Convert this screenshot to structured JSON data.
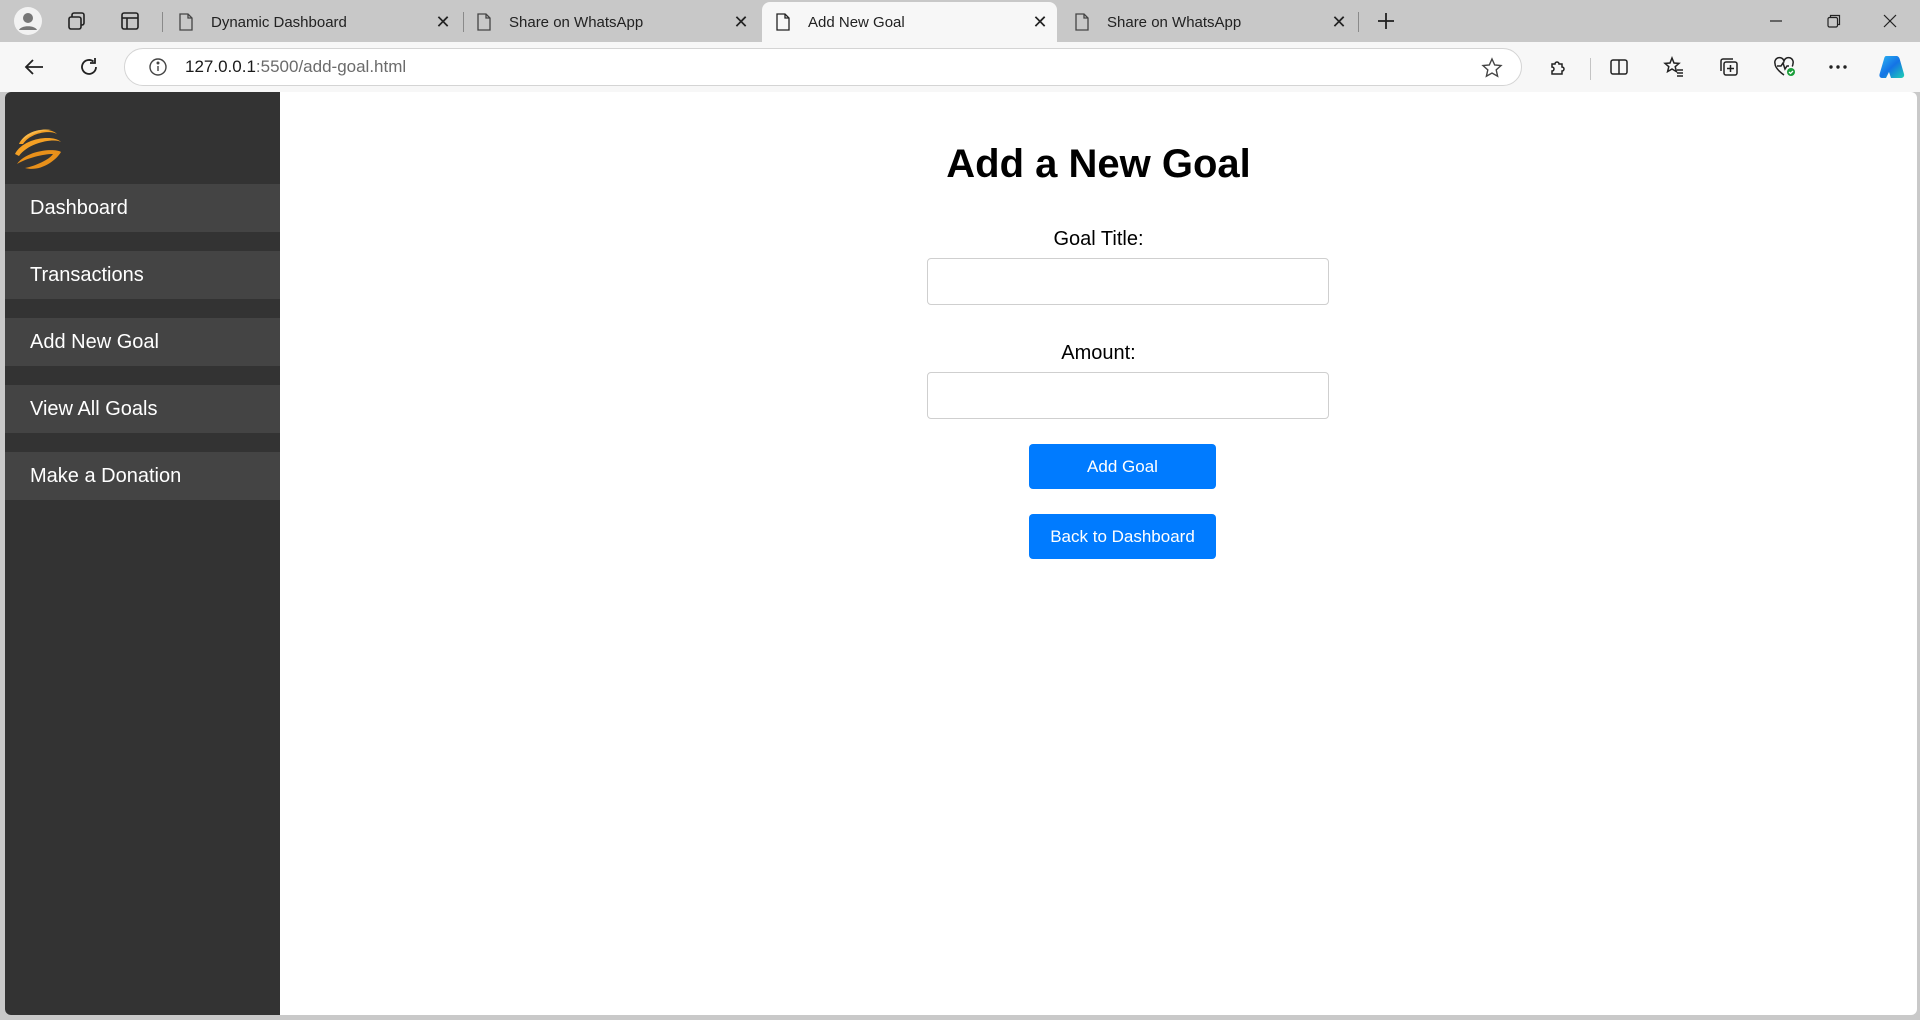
{
  "browser": {
    "tabs": [
      {
        "title": "Dynamic Dashboard",
        "active": false
      },
      {
        "title": "Share on WhatsApp",
        "active": false
      },
      {
        "title": "Add New Goal",
        "active": true
      },
      {
        "title": "Share on WhatsApp",
        "active": false
      }
    ],
    "url_host": "127.0.0.1",
    "url_rest": ":5500/add-goal.html"
  },
  "sidebar": {
    "items": [
      {
        "label": "Dashboard"
      },
      {
        "label": "Transactions"
      },
      {
        "label": "Add New Goal"
      },
      {
        "label": "View All Goals"
      },
      {
        "label": "Make a Donation"
      }
    ]
  },
  "form": {
    "title": "Add a New Goal",
    "goal_title_label": "Goal Title:",
    "goal_title_value": "",
    "amount_label": "Amount:",
    "amount_value": "",
    "add_button": "Add Goal",
    "back_button": "Back to Dashboard"
  },
  "colors": {
    "sidebar_bg": "#333333",
    "nav_item_bg": "#444444",
    "button_bg": "#007bff",
    "logo_orange": "#f4a024"
  }
}
